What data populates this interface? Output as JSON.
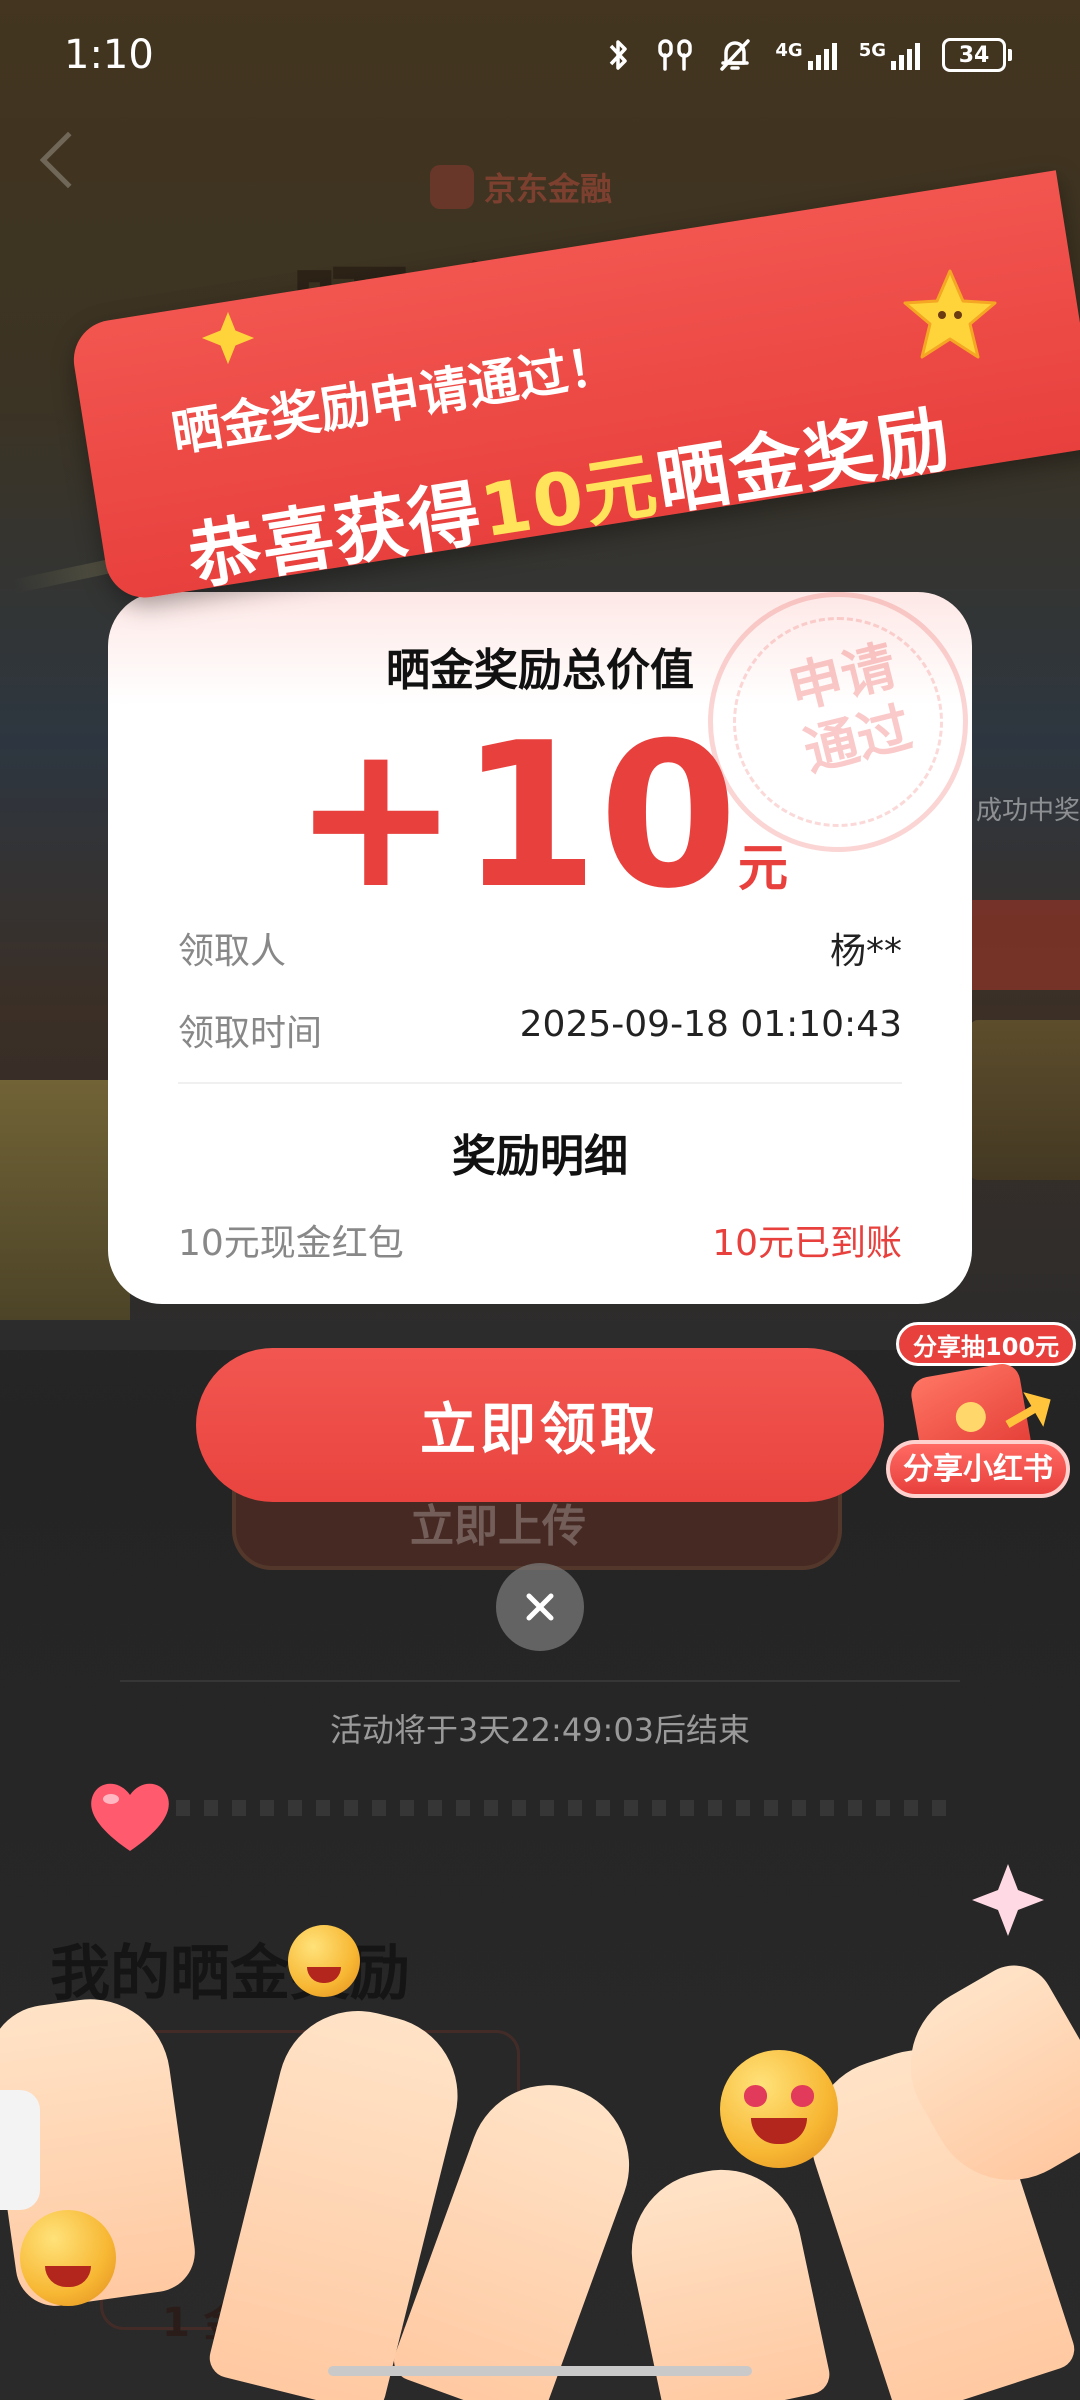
{
  "status_bar": {
    "time": "1:10",
    "net_4g": "4G",
    "net_5g": "5G",
    "battery": "34"
  },
  "background": {
    "logo_text": "京东金融",
    "big_title": "晒金得金",
    "side_hint": "成功中奖",
    "upload_label": "立即上传",
    "countdown": "活动将于3天22:49:03后结束",
    "my_rewards_title": "我的晒金奖励",
    "bottom_item": "1 金红包"
  },
  "banner": {
    "line1": "晒金奖励申请通过！",
    "line2_prefix": "恭喜获得",
    "line2_highlight": "10元",
    "line2_suffix": "晒金奖励"
  },
  "card": {
    "title": "晒金奖励总价值",
    "amount": "+10",
    "unit": "元",
    "stamp_line1": "申请",
    "stamp_line2": "通过",
    "recipient_label": "领取人",
    "recipient_value": "杨**",
    "time_label": "领取时间",
    "time_value": "2025-09-18 01:10:43",
    "details_title": "奖励明细",
    "detail_item": "10元现金红包",
    "detail_status": "10元已到账"
  },
  "claim_button": "立即领取",
  "share": {
    "badge": "分享抽100元",
    "label": "分享小红书"
  },
  "colors": {
    "accent": "#E8403D",
    "highlight": "#FFE35A"
  }
}
